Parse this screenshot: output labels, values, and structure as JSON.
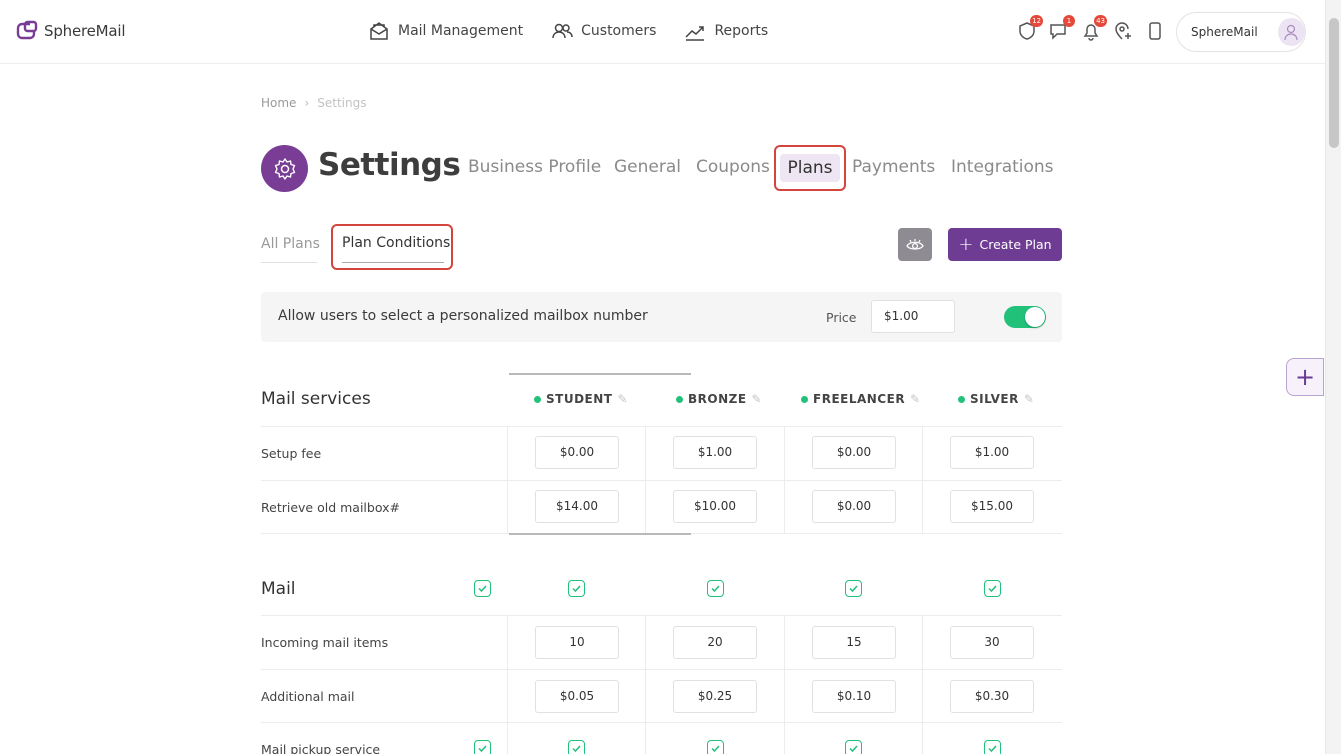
{
  "app": {
    "name": "SphereMail"
  },
  "nav": {
    "items": [
      {
        "label": "Mail Management",
        "icon": "mail-open-icon"
      },
      {
        "label": "Customers",
        "icon": "users-icon"
      },
      {
        "label": "Reports",
        "icon": "trend-icon"
      }
    ]
  },
  "notifications": {
    "shield_count": "12",
    "chat_count": "1",
    "bell_count": "43"
  },
  "account": {
    "name": "SphereMail"
  },
  "breadcrumb": {
    "home": "Home",
    "current": "Settings"
  },
  "page": {
    "title": "Settings"
  },
  "tabs": [
    "Business Profile",
    "General",
    "Coupons",
    "Plans",
    "Payments",
    "Integrations"
  ],
  "subtabs": {
    "all": "All Plans",
    "conditions": "Plan Conditions"
  },
  "actions": {
    "create_plan": "Create Plan"
  },
  "condition": {
    "label": "Allow users to select a personalized mailbox number",
    "price_label": "Price",
    "price_value": "$1.00",
    "enabled": true
  },
  "plans": [
    "STUDENT",
    "BRONZE",
    "FREELANCER",
    "SILVER"
  ],
  "mail_services": {
    "title": "Mail services",
    "rows": [
      {
        "label": "Setup fee",
        "values": [
          "$0.00",
          "$1.00",
          "$0.00",
          "$1.00"
        ]
      },
      {
        "label": "Retrieve old mailbox#",
        "values": [
          "$14.00",
          "$10.00",
          "$0.00",
          "$15.00"
        ]
      }
    ]
  },
  "mail": {
    "title": "Mail",
    "rows": [
      {
        "label": "Incoming mail items",
        "values": [
          "10",
          "20",
          "15",
          "30"
        ]
      },
      {
        "label": "Additional mail",
        "values": [
          "$0.05",
          "$0.25",
          "$0.10",
          "$0.30"
        ]
      },
      {
        "label": "Mail pickup service"
      }
    ]
  },
  "colors": {
    "accent": "#6e3d93",
    "toggle_on": "#22c17a",
    "highlight": "#d3453b"
  }
}
